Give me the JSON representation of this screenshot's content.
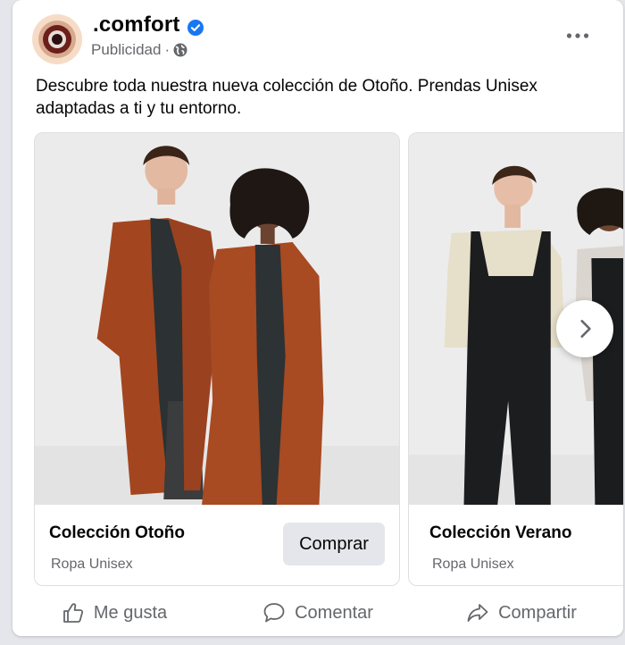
{
  "post": {
    "brand_name": ".comfort",
    "sponsored_label": "Publicidad",
    "separator": "·",
    "caption": "Descubre toda nuestra nueva colección de Otoño. Prendas Unisex adaptadas a ti y tu entorno.",
    "icons": {
      "verified": "verified-badge-icon",
      "privacy": "globe-icon",
      "more": "more-options-icon"
    }
  },
  "carousel": {
    "items": [
      {
        "title": "Colección Otoño",
        "subtitle": "Ropa Unisex",
        "cta": "Comprar"
      },
      {
        "title": "Colección Verano",
        "subtitle": "Ropa Unisex"
      }
    ],
    "next_icon": "chevron-right-icon"
  },
  "actions": [
    {
      "label": "Me gusta",
      "icon": "thumbs-up-icon"
    },
    {
      "label": "Comentar",
      "icon": "comment-icon"
    },
    {
      "label": "Compartir",
      "icon": "share-icon"
    }
  ],
  "colors": {
    "verified_blue": "#1877f2",
    "secondary_text": "#65676b",
    "button_bg": "#e4e6eb",
    "rust": "#a3461f"
  }
}
